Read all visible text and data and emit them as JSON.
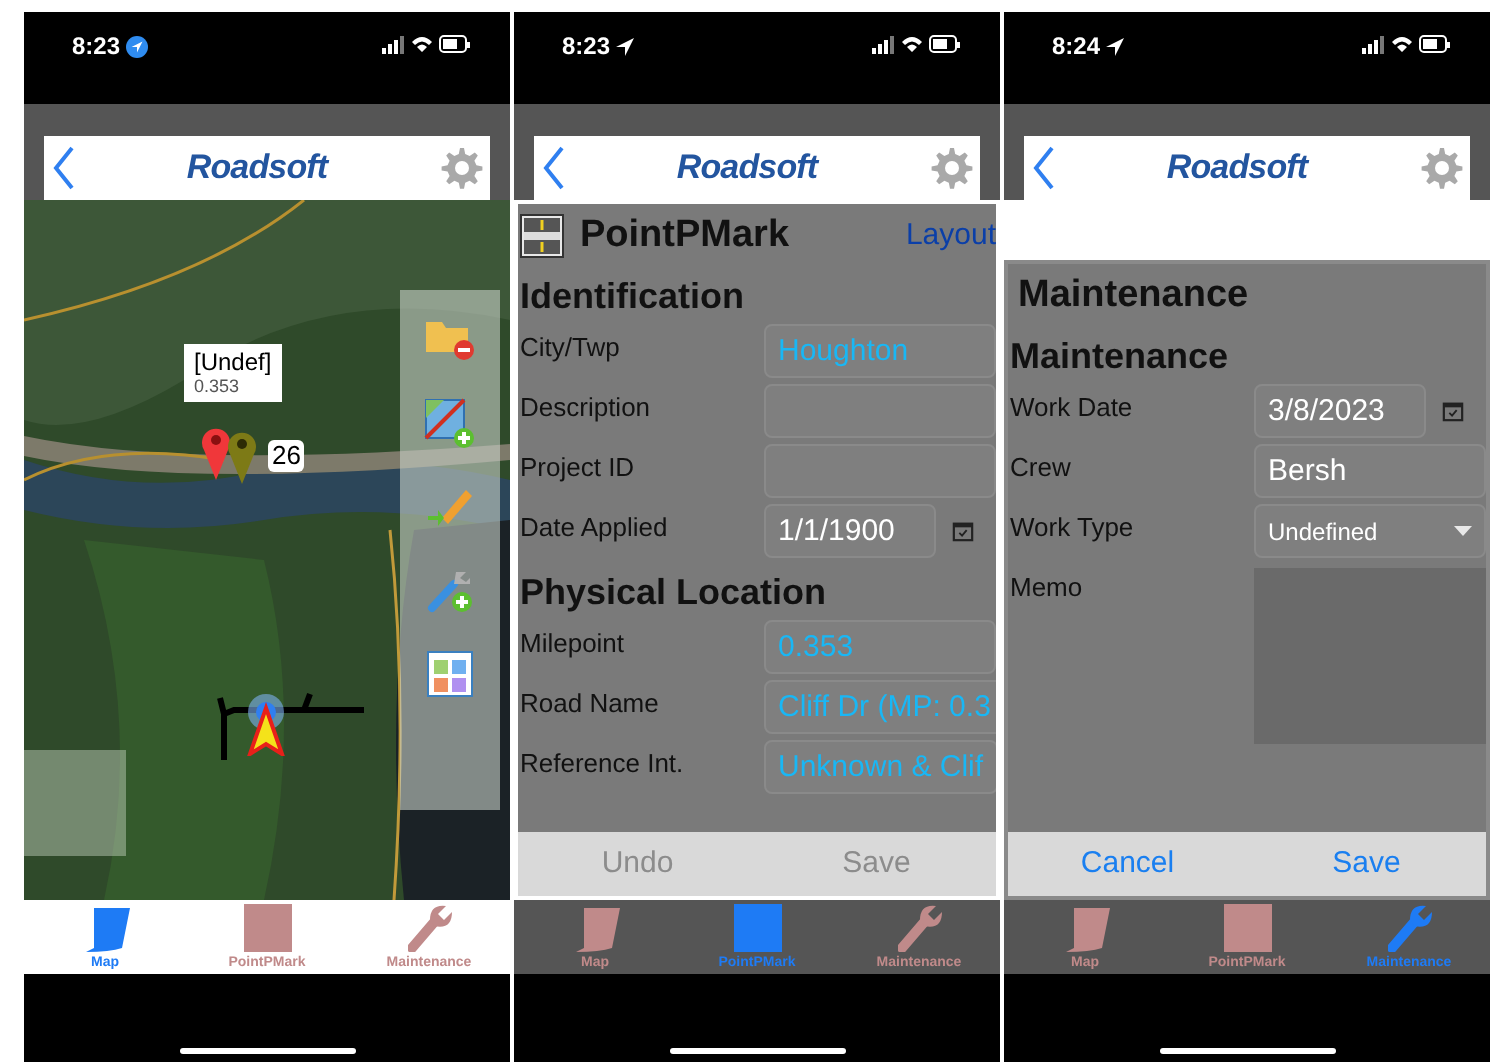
{
  "phones": [
    {
      "time": "8:23",
      "location_badge": true,
      "logo": "Roadsoft",
      "dimmed": false,
      "screen": {
        "kind": "map",
        "callout": {
          "title": "[Undef]",
          "subtitle": "0.353"
        },
        "marker_label": "26"
      },
      "tabs": [
        {
          "label": "Map",
          "kind": "map",
          "selected": true
        },
        {
          "label": "PointPMark",
          "kind": "square",
          "selected": false
        },
        {
          "label": "Maintenance",
          "kind": "wrench",
          "selected": false
        }
      ]
    },
    {
      "time": "8:23",
      "location_badge": false,
      "logo": "Roadsoft",
      "dimmed": true,
      "screen": {
        "kind": "form",
        "top_band": false,
        "title": "PointPMark",
        "title_icon": {
          "kind": "road"
        },
        "link": "Layout",
        "sections": [
          {
            "heading": "Identification",
            "fields": [
              {
                "label": "City/Twp",
                "kind": "text",
                "linked": true,
                "value": "Houghton"
              },
              {
                "label": "Description",
                "kind": "text"
              },
              {
                "label": "Project ID",
                "kind": "text"
              },
              {
                "label": "Date Applied",
                "kind": "date",
                "linked": false,
                "value": "1/1/1900"
              }
            ]
          },
          {
            "heading": "Physical Location",
            "fields": [
              {
                "label": "Milepoint",
                "kind": "text",
                "linked": true,
                "value": "0.353"
              },
              {
                "label": "Road Name",
                "kind": "text",
                "linked": true,
                "value": "Cliff Dr (MP: 0.3"
              },
              {
                "label": "Reference Int.",
                "kind": "text",
                "linked": true,
                "value": "Unknown & Clif"
              }
            ]
          }
        ],
        "buttons": [
          {
            "label": "Undo",
            "disabled": true
          },
          {
            "label": "Save",
            "disabled": true
          }
        ]
      },
      "tabs": [
        {
          "label": "Map",
          "kind": "map",
          "selected": false
        },
        {
          "label": "PointPMark",
          "kind": "square",
          "selected": true
        },
        {
          "label": "Maintenance",
          "kind": "wrench",
          "selected": false
        }
      ]
    },
    {
      "time": "8:24",
      "location_badge": false,
      "logo": "Roadsoft",
      "dimmed": true,
      "screen": {
        "kind": "form",
        "top_band": true,
        "title": "Maintenance",
        "sections": [
          {
            "heading": "Maintenance",
            "fields": [
              {
                "label": "Work Date",
                "kind": "date",
                "linked": false,
                "value": "3/8/2023"
              },
              {
                "label": "Crew",
                "kind": "text",
                "linked": false,
                "value": "Bersh"
              },
              {
                "label": "Work Type",
                "kind": "select",
                "linked": false,
                "value": "Undefined"
              },
              {
                "label": "Memo",
                "kind": "memo"
              }
            ]
          }
        ],
        "buttons": [
          {
            "label": "Cancel",
            "disabled": false
          },
          {
            "label": "Save",
            "disabled": false
          }
        ]
      },
      "tabs": [
        {
          "label": "Map",
          "kind": "map",
          "selected": false
        },
        {
          "label": "PointPMark",
          "kind": "square",
          "selected": false
        },
        {
          "label": "Maintenance",
          "kind": "wrench",
          "selected": true
        }
      ]
    }
  ]
}
